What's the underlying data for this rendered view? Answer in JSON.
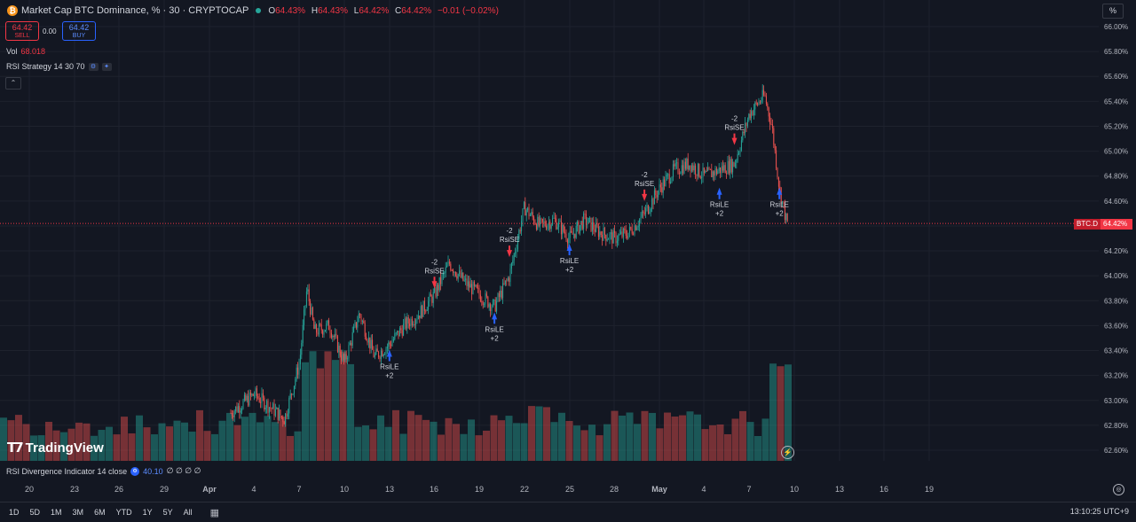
{
  "header": {
    "title": "Market Cap BTC Dominance, % · 30 · CRYPTOCAP",
    "ohlc": [
      {
        "k": "O",
        "v": "64.43%"
      },
      {
        "k": "H",
        "v": "64.43%"
      },
      {
        "k": "L",
        "v": "64.42%"
      },
      {
        "k": "C",
        "v": "64.42%"
      },
      {
        "k": "",
        "v": "−0.01 (−0.02%)"
      }
    ]
  },
  "trade": {
    "sell_price": "64.42",
    "sell_label": "SELL",
    "spread": "0.00",
    "buy_price": "64.42",
    "buy_label": "BUY"
  },
  "volume": {
    "label": "Vol",
    "value": "68.018"
  },
  "strategy": {
    "label": "RSI Strategy 14 30 70"
  },
  "scale_button": "%",
  "logo": "TradingView",
  "rsi_indicator": {
    "label": "RSI Divergence Indicator 14 close",
    "value": "40.10",
    "extra": "∅ ∅ ∅ ∅"
  },
  "price_badge": {
    "symbol": "BTC.D",
    "value": "64.42%"
  },
  "timeframes": [
    "1D",
    "5D",
    "1M",
    "3M",
    "6M",
    "YTD",
    "1Y",
    "5Y",
    "All"
  ],
  "clock": "13:10:25 UTC+9",
  "colors": {
    "background": "#131722",
    "up": "#26a69a",
    "down": "#ef5350",
    "buy_arrow": "#2962ff",
    "sell_arrow": "#f23645"
  },
  "chart_data": {
    "type": "candlestick",
    "title": "Market Cap BTC Dominance, %",
    "y_axis": {
      "ticks": [
        "66.00%",
        "65.80%",
        "65.60%",
        "65.40%",
        "65.20%",
        "65.00%",
        "64.80%",
        "64.60%",
        "64.40%",
        "64.20%",
        "64.00%",
        "63.80%",
        "63.60%",
        "63.40%",
        "63.20%",
        "63.00%",
        "62.80%",
        "62.60%"
      ],
      "ylim": [
        62.6,
        66.0
      ]
    },
    "x_axis": {
      "ticks": [
        "20",
        "23",
        "26",
        "29",
        "Apr",
        "4",
        "7",
        "10",
        "13",
        "16",
        "19",
        "22",
        "25",
        "28",
        "May",
        "4",
        "7",
        "10",
        "13",
        "16",
        "19"
      ]
    },
    "price_path": [
      {
        "x": "Apr 4",
        "y": 63.05
      },
      {
        "x": "Apr 5",
        "y": 62.95
      },
      {
        "x": "Apr 6",
        "y": 62.85
      },
      {
        "x": "Apr 7",
        "y": 63.3
      },
      {
        "x": "Apr 7.5",
        "y": 63.9
      },
      {
        "x": "Apr 8",
        "y": 63.55
      },
      {
        "x": "Apr 9",
        "y": 63.6
      },
      {
        "x": "Apr 10",
        "y": 63.3
      },
      {
        "x": "Apr 11",
        "y": 63.7
      },
      {
        "x": "Apr 12",
        "y": 63.35
      },
      {
        "x": "Apr 13",
        "y": 63.45
      },
      {
        "x": "Apr 14",
        "y": 63.6
      },
      {
        "x": "Apr 15",
        "y": 63.7
      },
      {
        "x": "Apr 16",
        "y": 63.85
      },
      {
        "x": "Apr 17",
        "y": 64.1
      },
      {
        "x": "Apr 18",
        "y": 63.95
      },
      {
        "x": "Apr 19",
        "y": 63.85
      },
      {
        "x": "Apr 20",
        "y": 63.75
      },
      {
        "x": "Apr 21",
        "y": 64.0
      },
      {
        "x": "Apr 22",
        "y": 64.55
      },
      {
        "x": "Apr 23",
        "y": 64.4
      },
      {
        "x": "Apr 24",
        "y": 64.45
      },
      {
        "x": "Apr 25",
        "y": 64.3
      },
      {
        "x": "Apr 26",
        "y": 64.45
      },
      {
        "x": "Apr 27",
        "y": 64.35
      },
      {
        "x": "Apr 28",
        "y": 64.3
      },
      {
        "x": "Apr 29",
        "y": 64.35
      },
      {
        "x": "Apr 30",
        "y": 64.5
      },
      {
        "x": "May 1",
        "y": 64.7
      },
      {
        "x": "May 2",
        "y": 64.85
      },
      {
        "x": "May 3",
        "y": 64.9
      },
      {
        "x": "May 4",
        "y": 64.8
      },
      {
        "x": "May 5",
        "y": 64.85
      },
      {
        "x": "May 6",
        "y": 64.9
      },
      {
        "x": "May 7",
        "y": 65.3
      },
      {
        "x": "May 8",
        "y": 65.45
      },
      {
        "x": "May 8.5",
        "y": 65.2
      },
      {
        "x": "May 9",
        "y": 64.7
      },
      {
        "x": "May 9.5",
        "y": 64.42
      }
    ],
    "signals": [
      {
        "type": "long",
        "label": "RsiLE",
        "qty": "+2",
        "x": "Apr 13",
        "y": 63.45
      },
      {
        "type": "short",
        "label": "RsiSE",
        "qty": "-2",
        "x": "Apr 16",
        "y": 63.85
      },
      {
        "type": "long",
        "label": "RsiLE",
        "qty": "+2",
        "x": "Apr 20",
        "y": 63.75
      },
      {
        "type": "short",
        "label": "RsiSE",
        "qty": "-2",
        "x": "Apr 21",
        "y": 64.1
      },
      {
        "type": "long",
        "label": "RsiLE",
        "qty": "+2",
        "x": "Apr 25",
        "y": 64.3
      },
      {
        "type": "short",
        "label": "RsiSE",
        "qty": "-2",
        "x": "Apr 30",
        "y": 64.55
      },
      {
        "type": "long",
        "label": "RsiLE",
        "qty": "+2",
        "x": "May 5",
        "y": 64.75
      },
      {
        "type": "short",
        "label": "RsiSE",
        "qty": "-2",
        "x": "May 6",
        "y": 65.0
      },
      {
        "type": "long",
        "label": "RsiLE",
        "qty": "+2",
        "x": "May 9",
        "y": 64.75
      }
    ],
    "last_price": 64.42,
    "grid": true
  }
}
